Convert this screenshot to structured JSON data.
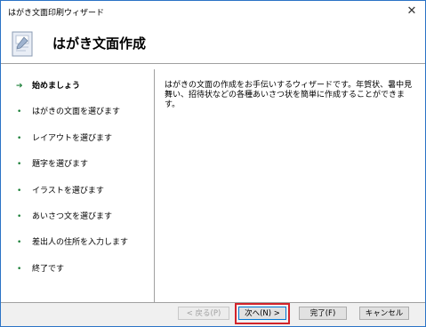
{
  "window": {
    "title": "はがき文面印刷ウィザード"
  },
  "header": {
    "title": "はがき文面作成",
    "icon": "postcard-wizard-icon"
  },
  "steps": [
    {
      "label": "始めましょう",
      "active": true,
      "marker": "➔"
    },
    {
      "label": "はがきの文面を選びます",
      "active": false,
      "marker": "•"
    },
    {
      "label": "レイアウトを選びます",
      "active": false,
      "marker": "•"
    },
    {
      "label": "題字を選びます",
      "active": false,
      "marker": "•"
    },
    {
      "label": "イラストを選びます",
      "active": false,
      "marker": "•"
    },
    {
      "label": "あいさつ文を選びます",
      "active": false,
      "marker": "•"
    },
    {
      "label": "差出人の住所を入力します",
      "active": false,
      "marker": "•"
    },
    {
      "label": "終了です",
      "active": false,
      "marker": "•"
    }
  ],
  "description": "はがきの文面の作成をお手伝いするウィザードです。年賀状、暑中見舞い、招待状などの各種あいさつ状を簡単に作成することができます。",
  "buttons": {
    "back": "< 戻る(P)",
    "next": "次へ(N) >",
    "finish": "完了(F)",
    "cancel": "キャンセル"
  },
  "colors": {
    "accent": "#0078d4",
    "highlight": "#d2232a",
    "step_marker": "#1a7f37"
  }
}
